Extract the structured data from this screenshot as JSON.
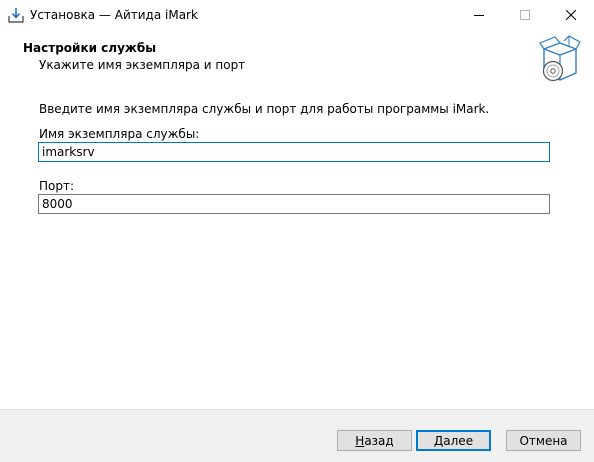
{
  "window": {
    "title": "Установка — Айтида iMark",
    "icon": "installer-download-icon",
    "controls": {
      "minimize": "minimize-icon",
      "maximize": "maximize-icon",
      "close": "close-icon"
    }
  },
  "header": {
    "title": "Настройки службы",
    "subtitle": "Укажите имя экземпляра и порт",
    "image": "software-box-disc-icon"
  },
  "content": {
    "intro": "Введите имя экземпляра службы и порт для работы программы iMark.",
    "instance": {
      "label": "Имя экземпляра службы:",
      "value": "imarksrv"
    },
    "port": {
      "label": "Порт:",
      "value": "8000"
    }
  },
  "footer": {
    "back_label_mnemonic": "Н",
    "back_label_rest": "азад",
    "next_label_mnemonic": "Д",
    "next_label_rest": "алее",
    "cancel_label": "Отмена"
  },
  "colors": {
    "accent": "#0078d7",
    "footer_bg": "#f0f0f0",
    "button_bg": "#e1e1e1"
  }
}
